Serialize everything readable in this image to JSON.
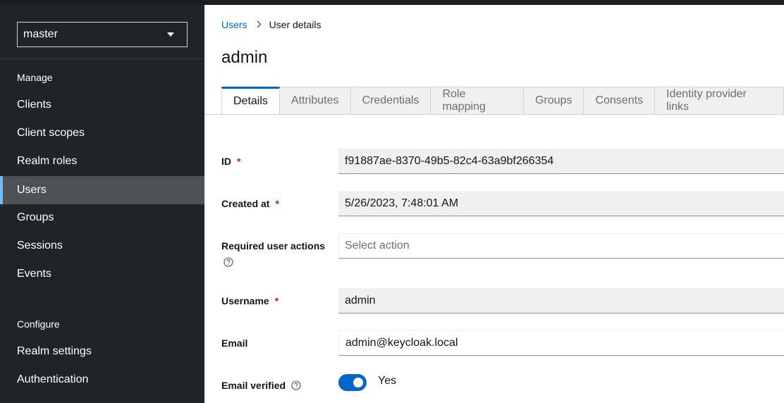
{
  "sidebar": {
    "realm": "master",
    "sections": [
      {
        "title": "Manage"
      },
      {
        "title": "Configure"
      }
    ],
    "manage_items": [
      {
        "label": "Clients"
      },
      {
        "label": "Client scopes"
      },
      {
        "label": "Realm roles"
      },
      {
        "label": "Users",
        "active": true
      },
      {
        "label": "Groups"
      },
      {
        "label": "Sessions"
      },
      {
        "label": "Events"
      }
    ],
    "configure_items": [
      {
        "label": "Realm settings"
      },
      {
        "label": "Authentication"
      }
    ]
  },
  "breadcrumb": {
    "parent": "Users",
    "current": "User details"
  },
  "page": {
    "title": "admin"
  },
  "tabs": [
    {
      "label": "Details",
      "active": true
    },
    {
      "label": "Attributes"
    },
    {
      "label": "Credentials"
    },
    {
      "label": "Role mapping"
    },
    {
      "label": "Groups"
    },
    {
      "label": "Consents"
    },
    {
      "label": "Identity provider links"
    }
  ],
  "form": {
    "id_label": "ID",
    "id_value": "f91887ae-8370-49b5-82c4-63a9bf266354",
    "created_label": "Created at",
    "created_value": "5/26/2023, 7:48:01 AM",
    "actions_label": "Required user actions",
    "actions_placeholder": "Select action",
    "username_label": "Username",
    "username_value": "admin",
    "email_label": "Email",
    "email_value": "admin@keycloak.local",
    "email_verified_label": "Email verified",
    "email_verified_value": "Yes",
    "required_marker": "*"
  },
  "colors": {
    "accent": "#0066cc",
    "sidebar_bg": "#212427",
    "active_nav_bg": "#4f5255",
    "required": "#c9190b"
  },
  "icons": {
    "help": "help-circle-icon",
    "caret": "caret-down-icon",
    "breadcrumb_separator": "chevron-right-icon"
  }
}
